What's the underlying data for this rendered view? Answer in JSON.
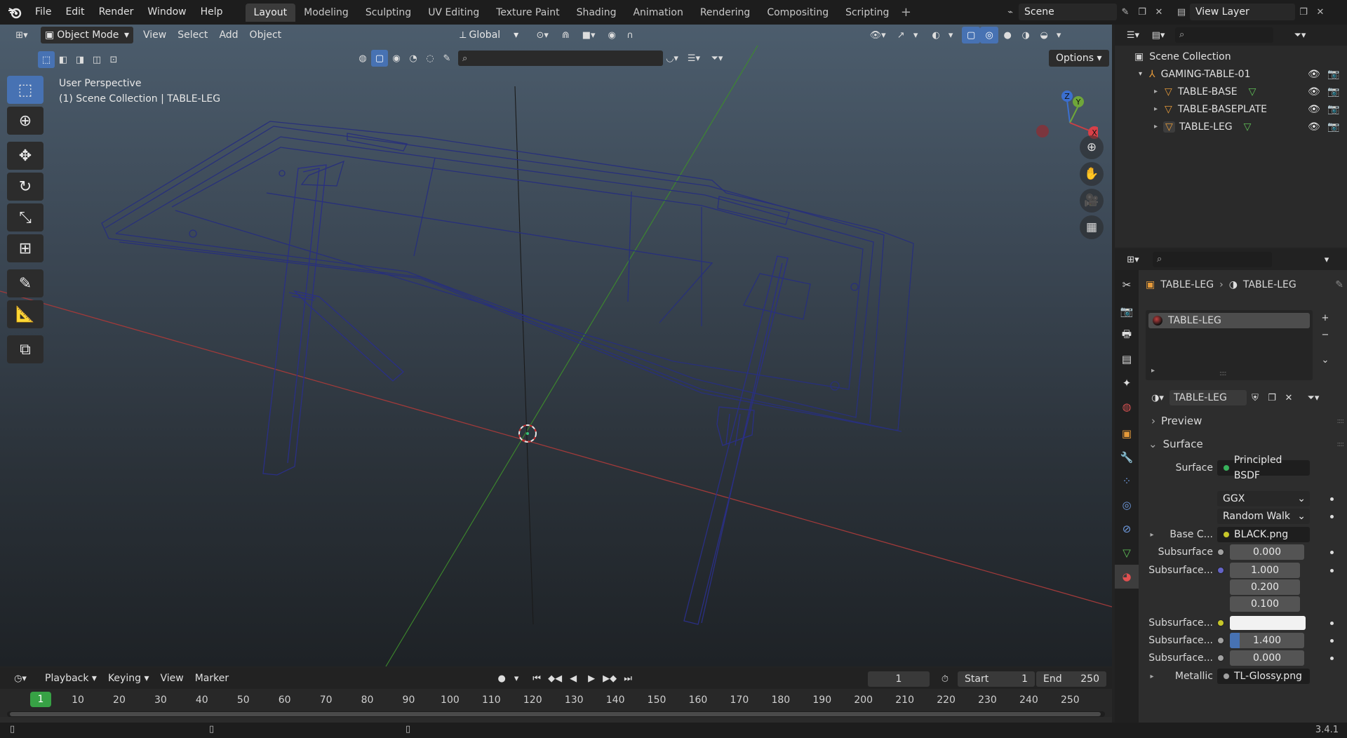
{
  "topbar": {
    "menus": [
      "File",
      "Edit",
      "Render",
      "Window",
      "Help"
    ],
    "workspaces": [
      "Layout",
      "Modeling",
      "Sculpting",
      "UV Editing",
      "Texture Paint",
      "Shading",
      "Animation",
      "Rendering",
      "Compositing",
      "Scripting"
    ],
    "active_workspace": "Layout",
    "scene": "Scene",
    "view_layer": "View Layer"
  },
  "viewport": {
    "mode": "Object Mode",
    "menus": [
      "View",
      "Select",
      "Add",
      "Object"
    ],
    "orientation": "Global",
    "perspective_label": "User Perspective",
    "collection_label": "(1) Scene Collection | TABLE-LEG",
    "options_label": "Options",
    "gizmo": {
      "x": "X",
      "y": "Y",
      "z": "Z"
    }
  },
  "timeline": {
    "menus": [
      "Playback",
      "Keying",
      "View",
      "Marker"
    ],
    "current_frame": "1",
    "start_label": "Start",
    "start": "1",
    "end_label": "End",
    "end": "250",
    "ticks": [
      "1",
      "10",
      "20",
      "30",
      "40",
      "50",
      "60",
      "70",
      "80",
      "90",
      "100",
      "110",
      "120",
      "130",
      "140",
      "150",
      "160",
      "170",
      "180",
      "190",
      "200",
      "210",
      "220",
      "230",
      "240",
      "250"
    ]
  },
  "status": {
    "version": "3.4.1"
  },
  "outliner": {
    "root": "Scene Collection",
    "collection": "GAMING-TABLE-01",
    "objects": [
      "TABLE-BASE",
      "TABLE-BASEPLATE",
      "TABLE-LEG"
    ]
  },
  "properties": {
    "breadcrumb_object": "TABLE-LEG",
    "breadcrumb_material": "TABLE-LEG",
    "slot_name": "TABLE-LEG",
    "material_name": "TABLE-LEG",
    "panels": {
      "preview": "Preview",
      "surface": "Surface"
    },
    "surface_label": "Surface",
    "surface_value": "Principled BSDF",
    "distribution": "GGX",
    "subsurface_method": "Random Walk",
    "rows": {
      "base_color": {
        "label": "Base C...",
        "value": "BLACK.png"
      },
      "subsurface": {
        "label": "Subsurface",
        "value": "0.000"
      },
      "subsurface_radius": {
        "label": "Subsurface...",
        "values": [
          "1.000",
          "0.200",
          "0.100"
        ]
      },
      "subsurface_color": {
        "label": "Subsurface..."
      },
      "subsurface_ior": {
        "label": "Subsurface...",
        "value": "1.400"
      },
      "subsurface_aniso": {
        "label": "Subsurface...",
        "value": "0.000"
      },
      "metallic": {
        "label": "Metallic",
        "value": "TL-Glossy.png"
      }
    }
  },
  "colors": {
    "accent": "#4772b3",
    "frame_green": "#37a245",
    "wire": "#2a2f7a",
    "axis_x": "#b03030",
    "axis_y": "#3f8f2a"
  }
}
